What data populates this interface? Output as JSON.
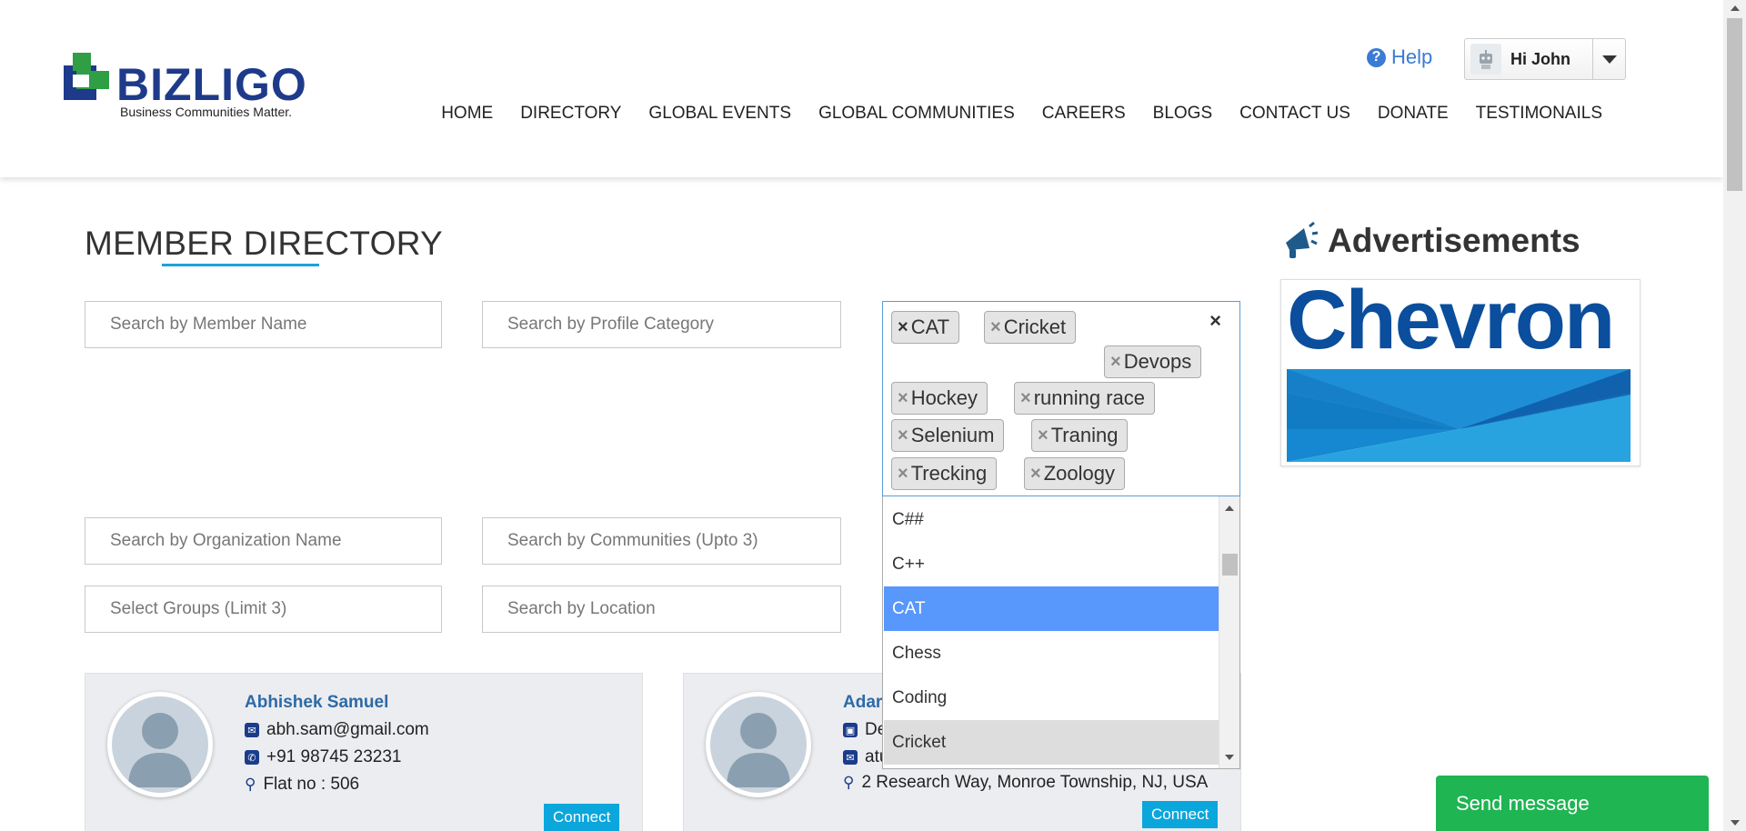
{
  "brand": {
    "name": "BIZLIGO",
    "tagline": "Business Communities Matter.",
    "colors": {
      "primary": "#1e3a8a",
      "green": "#2f9e44",
      "accent": "#1ba3d6"
    }
  },
  "header": {
    "help_label": "Help",
    "help_icon": "question-circle-icon",
    "user_greeting": "Hi John",
    "nav": [
      "HOME",
      "DIRECTORY",
      "GLOBAL EVENTS",
      "GLOBAL COMMUNITIES",
      "CAREERS",
      "BLOGS",
      "CONTACT US",
      "DONATE",
      "TESTIMONAILS"
    ]
  },
  "page": {
    "title": "MEMBER DIRECTORY"
  },
  "search": {
    "member_name": "Search by Member Name",
    "profile_category": "Search by Profile Category",
    "organization": "Search by Organization Name",
    "communities": "Search by Communities (Upto 3)",
    "groups": "Select Groups (Limit 3)",
    "location": "Search by Location"
  },
  "interests": {
    "clear_symbol": "×",
    "tags": [
      "CAT",
      "Cricket",
      "Devops",
      "Hockey",
      "running race",
      "Selenium",
      "Traning",
      "Trecking",
      "Zoology"
    ],
    "options": [
      "C##",
      "C++",
      "CAT",
      "Chess",
      "Coding",
      "Cricket"
    ],
    "highlighted_option": "CAT",
    "highlight_color": "#5897fb"
  },
  "ads": {
    "title": "Advertisements",
    "icon": "megaphone-icon",
    "banner_text": "Chevron"
  },
  "members": [
    {
      "name": "Abhishek Samuel",
      "email": "abh.sam@gmail.com",
      "phone": "+91 98745 23231",
      "address": "Flat no : 506",
      "connect_label": "Connect"
    },
    {
      "name": "Adar",
      "designation": "De",
      "email": "atu",
      "address": "2 Research Way, Monroe Township, NJ, USA",
      "connect_label": "Connect"
    }
  ],
  "chat": {
    "label": "Send message",
    "color": "#1fb552"
  }
}
